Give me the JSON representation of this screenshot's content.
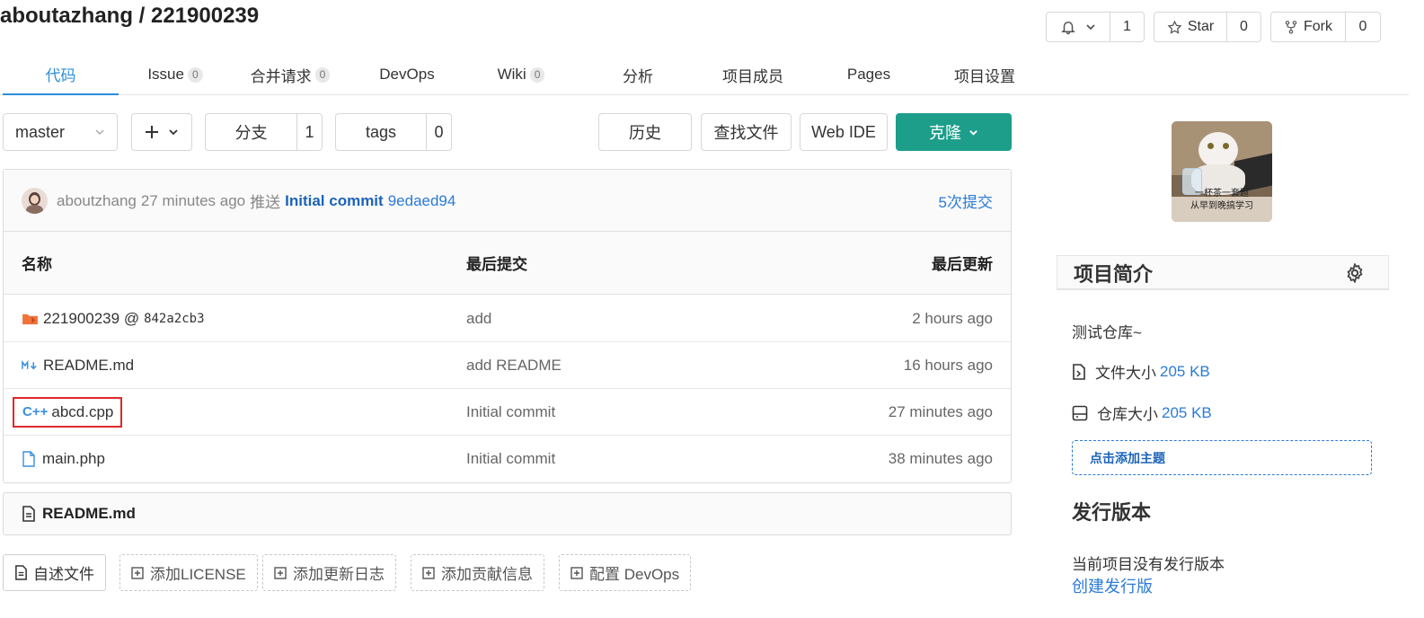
{
  "repo": {
    "title": "aboutazhang / 221900239"
  },
  "header_buttons": {
    "watch_count": "1",
    "star_label": "Star",
    "star_count": "0",
    "fork_label": "Fork",
    "fork_count": "0"
  },
  "tabs": [
    {
      "label": "代码",
      "count": null,
      "active": true
    },
    {
      "label": "Issue",
      "count": "0"
    },
    {
      "label": "合并请求",
      "count": "0"
    },
    {
      "label": "DevOps",
      "count": null
    },
    {
      "label": "Wiki",
      "count": "0"
    },
    {
      "label": "分析",
      "count": null
    },
    {
      "label": "项目成员",
      "count": null
    },
    {
      "label": "Pages",
      "count": null
    },
    {
      "label": "项目设置",
      "count": null
    }
  ],
  "toolbar": {
    "branch": "master",
    "branches_label": "分支",
    "branches_count": "1",
    "tags_label": "tags",
    "tags_count": "0",
    "history_label": "历史",
    "find_file_label": "查找文件",
    "web_ide_label": "Web IDE",
    "clone_label": "克隆"
  },
  "commit": {
    "author": "aboutzhang",
    "time": "27 minutes ago",
    "action": "推送",
    "message": "Initial commit",
    "hash": "9edaed94",
    "commits_link": "5次提交"
  },
  "table": {
    "headers": {
      "name": "名称",
      "last_commit": "最后提交",
      "last_update": "最后更新"
    },
    "rows": [
      {
        "icon": "submodule-icon",
        "name": "221900239 @",
        "extra": "842a2cb3",
        "commit": "add",
        "updated": "2 hours ago"
      },
      {
        "icon": "markdown-icon",
        "name": "README.md",
        "extra": "",
        "commit": "add README",
        "updated": "16 hours ago"
      },
      {
        "icon": "cpp-icon",
        "name": "abcd.cpp",
        "extra": "",
        "commit": "Initial commit",
        "updated": "27 minutes ago"
      },
      {
        "icon": "file-icon",
        "name": "main.php",
        "extra": "",
        "commit": "Initial commit",
        "updated": "38 minutes ago"
      }
    ]
  },
  "readme": {
    "title": "README.md"
  },
  "bottom_buttons": {
    "readme_file": "自述文件",
    "add_license": "添加LICENSE",
    "add_changelog": "添加更新日志",
    "add_contributing": "添加贡献信息",
    "config_devops": "配置 DevOps"
  },
  "sidebar": {
    "avatar_caption_1": "一杯茶一套题",
    "avatar_caption_2": "从早到晚搞学习",
    "intro_title": "项目简介",
    "description": "测试仓库~",
    "file_size_label": "文件大小",
    "file_size_value": "205 KB",
    "repo_size_label": "仓库大小",
    "repo_size_value": "205 KB",
    "add_topic": "点击添加主题",
    "releases_title": "发行版本",
    "no_releases": "当前项目没有发行版本",
    "create_release": "创建发行版"
  },
  "colors": {
    "accent": "#2b8ed9",
    "clone_button": "#1c9e8a",
    "link": "#2b7bd6",
    "highlight_box": "#e0292b"
  }
}
